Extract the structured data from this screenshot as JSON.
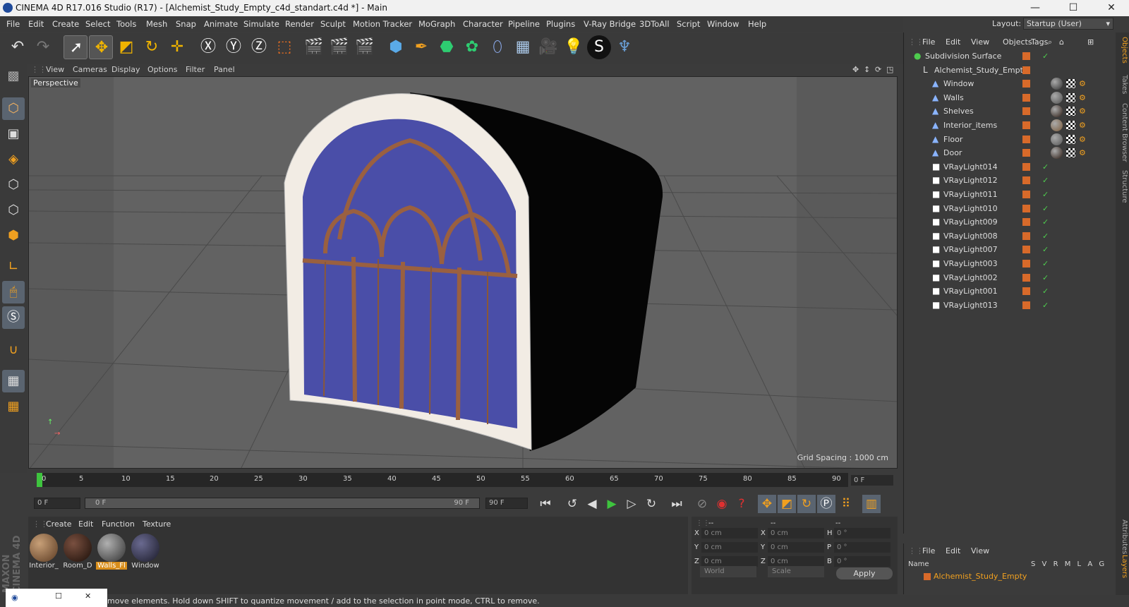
{
  "title": "CINEMA 4D R17.016 Studio (R17) - [Alchemist_Study_Empty_c4d_standart.c4d *] - Main",
  "window_controls": {
    "minimize": "—",
    "maximize": "☐",
    "close": "✕"
  },
  "menu": [
    "File",
    "Edit",
    "Create",
    "Select",
    "Tools",
    "Mesh",
    "Snap",
    "Animate",
    "Simulate",
    "Render",
    "Sculpt",
    "Motion Tracker",
    "MoGraph",
    "Character",
    "Pipeline",
    "Plugins",
    "V-Ray Bridge",
    "3DToAll",
    "Script",
    "Window",
    "Help"
  ],
  "layout": {
    "label": "Layout:",
    "value": "Startup (User)"
  },
  "viewport": {
    "menu": [
      "View",
      "Cameras",
      "Display",
      "Options",
      "Filter",
      "Panel"
    ],
    "label": "Perspective",
    "grid_spacing": "Grid Spacing : 1000 cm"
  },
  "timeline": {
    "ticks": [
      "0",
      "5",
      "10",
      "15",
      "20",
      "25",
      "30",
      "35",
      "40",
      "45",
      "50",
      "55",
      "60",
      "65",
      "70",
      "75",
      "80",
      "85",
      "90"
    ],
    "current": "0 F"
  },
  "transport": {
    "start": "0 F",
    "range_start": "0 F",
    "range_end": "90 F",
    "end": "90 F"
  },
  "materials": {
    "menu": [
      "Create",
      "Edit",
      "Function",
      "Texture"
    ],
    "items": [
      {
        "name": "Interior_",
        "color": "#7a5a3a"
      },
      {
        "name": "Room_D",
        "color": "#3a2418"
      },
      {
        "name": "Walls_Fl",
        "color": "#707070",
        "selected": true
      },
      {
        "name": "Window",
        "color": "#3a3a50"
      }
    ]
  },
  "coords": {
    "header": [
      "--",
      "--",
      "--"
    ],
    "rows": [
      {
        "a": "X",
        "av": "0 cm",
        "b": "X",
        "bv": "0 cm",
        "c": "H",
        "cv": "0 °"
      },
      {
        "a": "Y",
        "av": "0 cm",
        "b": "Y",
        "bv": "0 cm",
        "c": "P",
        "cv": "0 °"
      },
      {
        "a": "Z",
        "av": "0 cm",
        "b": "Z",
        "bv": "0 cm",
        "c": "B",
        "cv": "0 °"
      }
    ],
    "mode": "World",
    "scale": "Scale",
    "apply": "Apply"
  },
  "status": "move elements. Hold down SHIFT to quantize movement / add to the selection in point mode, CTRL to remove.",
  "objects": {
    "menu": [
      "File",
      "Edit",
      "View",
      "Objects",
      "Tags"
    ],
    "items": [
      {
        "name": "Subdivision Surface",
        "indent": 0,
        "icon": "●",
        "icolor": "#4ecc4e",
        "check": true
      },
      {
        "name": "Alchemist_Study_Empty",
        "indent": 1,
        "icon": "L",
        "icolor": "#ddd",
        "check": false
      },
      {
        "name": "Window",
        "indent": 2,
        "icon": "▲",
        "icolor": "#8ab4ff",
        "tags": true,
        "tagcolor": "#303030"
      },
      {
        "name": "Walls",
        "indent": 2,
        "icon": "▲",
        "icolor": "#8ab4ff",
        "tags": true,
        "tagcolor": "#505050"
      },
      {
        "name": "Shelves",
        "indent": 2,
        "icon": "▲",
        "icolor": "#8ab4ff",
        "tags": true,
        "tagcolor": "#2a1a12"
      },
      {
        "name": "Interior_items",
        "indent": 2,
        "icon": "▲",
        "icolor": "#8ab4ff",
        "tags": true,
        "tagcolor": "#7a5a3a"
      },
      {
        "name": "Floor",
        "indent": 2,
        "icon": "▲",
        "icolor": "#8ab4ff",
        "tags": true,
        "tagcolor": "#555"
      },
      {
        "name": "Door",
        "indent": 2,
        "icon": "▲",
        "icolor": "#8ab4ff",
        "tags": true,
        "tagcolor": "#2a1a12"
      },
      {
        "name": "VRayLight014",
        "indent": 2,
        "icon": "■",
        "icolor": "#fff",
        "check": true
      },
      {
        "name": "VRayLight012",
        "indent": 2,
        "icon": "■",
        "icolor": "#fff",
        "check": true
      },
      {
        "name": "VRayLight011",
        "indent": 2,
        "icon": "■",
        "icolor": "#fff",
        "check": true
      },
      {
        "name": "VRayLight010",
        "indent": 2,
        "icon": "■",
        "icolor": "#fff",
        "check": true
      },
      {
        "name": "VRayLight009",
        "indent": 2,
        "icon": "■",
        "icolor": "#fff",
        "check": true
      },
      {
        "name": "VRayLight008",
        "indent": 2,
        "icon": "■",
        "icolor": "#fff",
        "check": true
      },
      {
        "name": "VRayLight007",
        "indent": 2,
        "icon": "■",
        "icolor": "#fff",
        "check": true
      },
      {
        "name": "VRayLight003",
        "indent": 2,
        "icon": "■",
        "icolor": "#fff",
        "check": true
      },
      {
        "name": "VRayLight002",
        "indent": 2,
        "icon": "■",
        "icolor": "#fff",
        "check": true
      },
      {
        "name": "VRayLight001",
        "indent": 2,
        "icon": "■",
        "icolor": "#fff",
        "check": true
      },
      {
        "name": "VRayLight013",
        "indent": 2,
        "icon": "■",
        "icolor": "#fff",
        "check": true
      }
    ]
  },
  "layers": {
    "menu": [
      "File",
      "Edit",
      "View"
    ],
    "header": {
      "name": "Name",
      "cols": [
        "S",
        "V",
        "R",
        "M",
        "L",
        "A",
        "G"
      ]
    },
    "item": "Alchemist_Study_Empty"
  },
  "sidetabs": [
    "Objects",
    "Takes",
    "Content Browser",
    "Structure",
    "Attributes",
    "Layers"
  ],
  "maxon": "MAXON CINEMA 4D"
}
